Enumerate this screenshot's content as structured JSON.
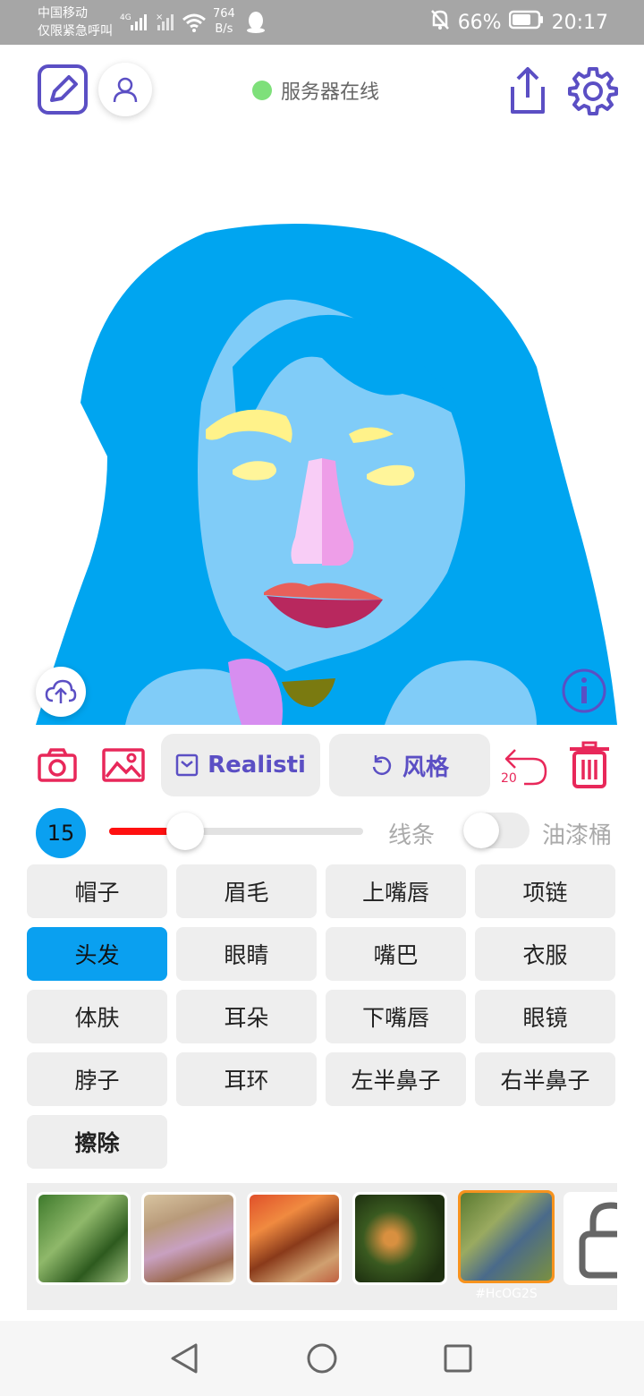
{
  "status_bar": {
    "carrier_line1": "中国移动",
    "carrier_line2": "仅限紧急呼叫",
    "net_type": "4G",
    "speed_value": "764",
    "speed_unit": "B/s",
    "battery": "66%",
    "time": "20:17"
  },
  "header": {
    "server_status": "服务器在线",
    "server_status_color": "#7ee07a"
  },
  "toolbar": {
    "mode_label": "Realisti",
    "style_label": "风格",
    "undo_count": "20",
    "accent_color": "#5b4fc4",
    "danger_color": "#e8285a"
  },
  "brush": {
    "size": "15",
    "level": 0.3,
    "line_label": "线条",
    "bucket_label": "油漆桶",
    "bucket_on": false
  },
  "parts": [
    {
      "label": "帽子"
    },
    {
      "label": "眉毛"
    },
    {
      "label": "上嘴唇"
    },
    {
      "label": "项链"
    },
    {
      "label": "头发",
      "active": true
    },
    {
      "label": "眼睛"
    },
    {
      "label": "嘴巴"
    },
    {
      "label": "衣服"
    },
    {
      "label": "体肤"
    },
    {
      "label": "耳朵"
    },
    {
      "label": "下嘴唇"
    },
    {
      "label": "眼镜"
    },
    {
      "label": "脖子"
    },
    {
      "label": "耳环"
    },
    {
      "label": "左半鼻子"
    },
    {
      "label": "右半鼻子"
    },
    {
      "label": "擦除",
      "bold": true
    }
  ],
  "styles": {
    "selected_tag": "#HcOG2S",
    "selected_index": 4
  },
  "colors": {
    "hair": "#00a5f0",
    "skin": "#80ccf8",
    "eyebrow": "#fff28a",
    "eye": "#fff59a",
    "nose_left": "#f8cdf6",
    "nose_right": "#ee9ee8",
    "upper_lip": "#e8605a",
    "lower_lip": "#b8285e",
    "hand": "#d78ef0",
    "necklace": "#7a7a10",
    "star": "#f7e227"
  }
}
